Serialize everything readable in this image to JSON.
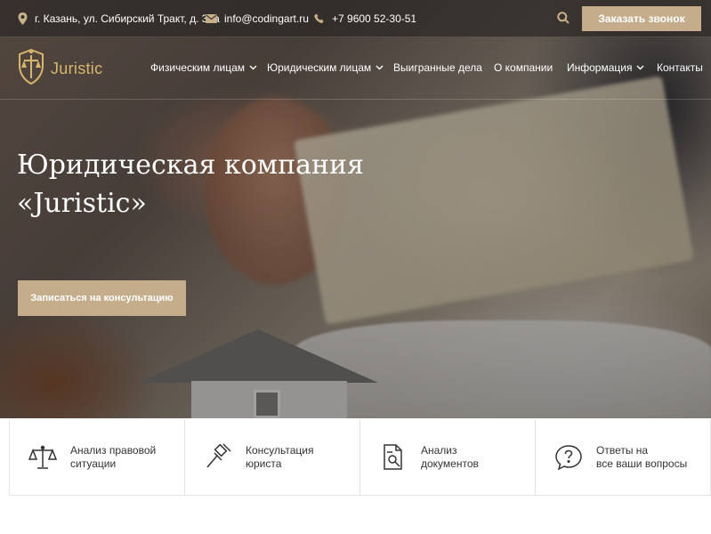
{
  "topbar": {
    "address": "г. Казань, ул. Сибирский Тракт, д. 34а",
    "email": "info@codingart.ru",
    "phone": "+7 9600 52-30-51",
    "callback_label": "Заказать звонок",
    "icons": {
      "address": "location-pin-icon",
      "email": "envelope-icon",
      "phone": "phone-icon",
      "search": "search-icon"
    }
  },
  "header": {
    "logo_text": "Juristic",
    "nav": [
      {
        "label": "Физическим лицам",
        "dropdown": true
      },
      {
        "label": "Юридическим лицам",
        "dropdown": true
      },
      {
        "label": "Выигранные дела",
        "dropdown": false
      },
      {
        "label": "О компании",
        "dropdown": false
      },
      {
        "label": "Информация",
        "dropdown": true
      },
      {
        "label": "Контакты",
        "dropdown": false
      }
    ]
  },
  "hero": {
    "title_line1": "Юридическая компания",
    "title_line2": "«Juristic»",
    "cta_label": "Записаться на консультацию"
  },
  "services": [
    {
      "line1": "Анализ правовой",
      "line2": "ситуации",
      "icon": "scales-icon"
    },
    {
      "line1": "Консультация",
      "line2": "юриста",
      "icon": "gavel-icon"
    },
    {
      "line1": "Анализ",
      "line2": "документов",
      "icon": "document-search-icon"
    },
    {
      "line1": "Ответы на",
      "line2": "все ваши вопросы",
      "icon": "question-bubble-icon"
    }
  ],
  "colors": {
    "accent": "#c5ad8b",
    "logo_gold": "#d8b56f",
    "topbar_bg": "#2c2826"
  }
}
